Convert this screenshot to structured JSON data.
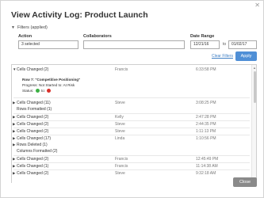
{
  "title": "View Activity Log: Product Launch",
  "close_icon": "close-icon",
  "filters": {
    "toggle_label": "Filters",
    "toggle_note": "(applied)",
    "action_label": "Action",
    "action_value": "3 selected",
    "collaborators_label": "Collaborators",
    "collaborators_value": "",
    "date_range_label": "Date Range",
    "date_from": "12/21/16",
    "to_label": "to",
    "date_to": "01/02/17",
    "clear_label": "Clear Filters",
    "apply_label": "Apply"
  },
  "log": {
    "rows": [
      {
        "text": "Cells Changed (2)",
        "name": "Francis",
        "time": "6:33:58 PM",
        "expanded": true
      },
      {
        "text": "Cells Changed (11)",
        "name": "Steve",
        "time": "3:08:25 PM"
      },
      {
        "text": "Rows Formatted (1)",
        "name": "",
        "time": ""
      },
      {
        "text": "Cells Changed (2)",
        "name": "Kelly",
        "time": "2:47:28 PM"
      },
      {
        "text": "Cells Changed (2)",
        "name": "Steve",
        "time": "2:44:35 PM"
      },
      {
        "text": "Cells Changed (2)",
        "name": "Steve",
        "time": "1:11:13 PM"
      },
      {
        "text": "Cells Changed (17)",
        "name": "Linda",
        "time": "1:10:56 PM"
      },
      {
        "text": "Rows Deleted (1)",
        "name": "",
        "time": ""
      },
      {
        "text": "Columns Formatted (2)",
        "name": "",
        "time": ""
      },
      {
        "text": "Cells Changed (2)",
        "name": "Francis",
        "time": "12:45:49 PM"
      },
      {
        "text": "Cells Changed (1)",
        "name": "Francis",
        "time": "11:14:38 AM"
      },
      {
        "text": "Cells Changed (2)",
        "name": "Steve",
        "time": "9:32:18 AM"
      }
    ],
    "detail": {
      "row_label": "Row 7: \"Competitive Positioning\"",
      "progress_label": "Progress:",
      "progress_from": "Not Started",
      "progress_to_word": "to:",
      "progress_to": "At Risk",
      "status_label": "Status:",
      "status_to_word": "to:",
      "status_from_color": "#3cb043",
      "status_to_color": "#d9302a"
    }
  },
  "footer": {
    "close_label": "Close"
  },
  "colors": {
    "accent": "#4f8fd6",
    "link": "#3f7fc4",
    "close_button": "#8a8a8a"
  }
}
